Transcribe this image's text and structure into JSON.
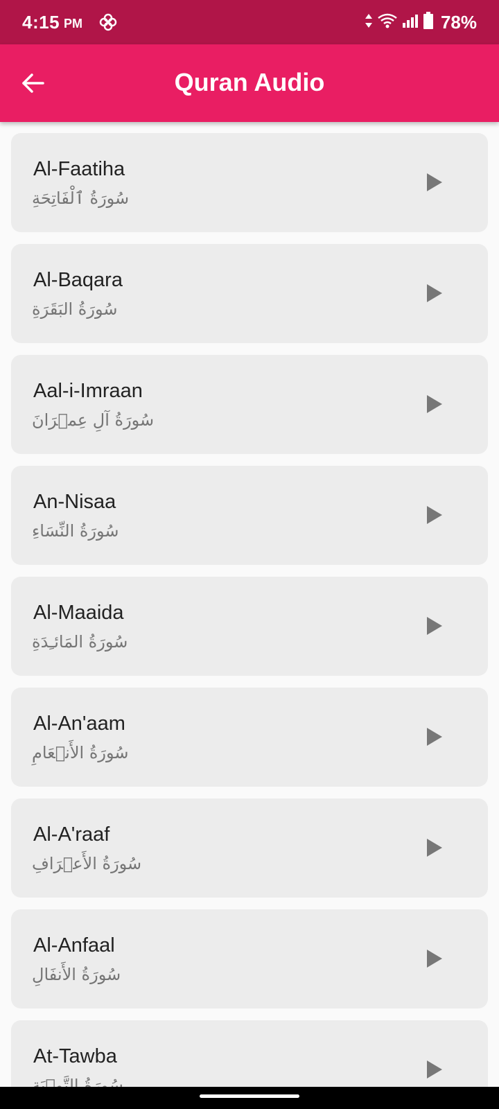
{
  "status_bar": {
    "time": "4:15",
    "ampm": "PM",
    "battery": "78%"
  },
  "app_bar": {
    "title": "Quran Audio"
  },
  "surahs": [
    {
      "name": "Al-Faatiha",
      "arabic": "سُورَةُ ٱلْفَاتِحَةِ"
    },
    {
      "name": "Al-Baqara",
      "arabic": "سُورَةُ البَقَرَةِ"
    },
    {
      "name": "Aal-i-Imraan",
      "arabic": "سُورَةُ آلِ عِمۡرَانَ"
    },
    {
      "name": "An-Nisaa",
      "arabic": "سُورَةُ النِّسَاءِ"
    },
    {
      "name": "Al-Maaida",
      "arabic": "سُورَةُ المَائـِدَةِ"
    },
    {
      "name": "Al-An'aam",
      "arabic": "سُورَةُ الأَنۡعَامِ"
    },
    {
      "name": "Al-A'raaf",
      "arabic": "سُورَةُ الأَعۡرَافِ"
    },
    {
      "name": "Al-Anfaal",
      "arabic": "سُورَةُ الأَنفَالِ"
    },
    {
      "name": "At-Tawba",
      "arabic": "سُورَةُ التَّوۡبَةِ"
    }
  ],
  "colors": {
    "status_bar": "#b01548",
    "app_bar": "#e91e63",
    "card": "#ececec"
  }
}
